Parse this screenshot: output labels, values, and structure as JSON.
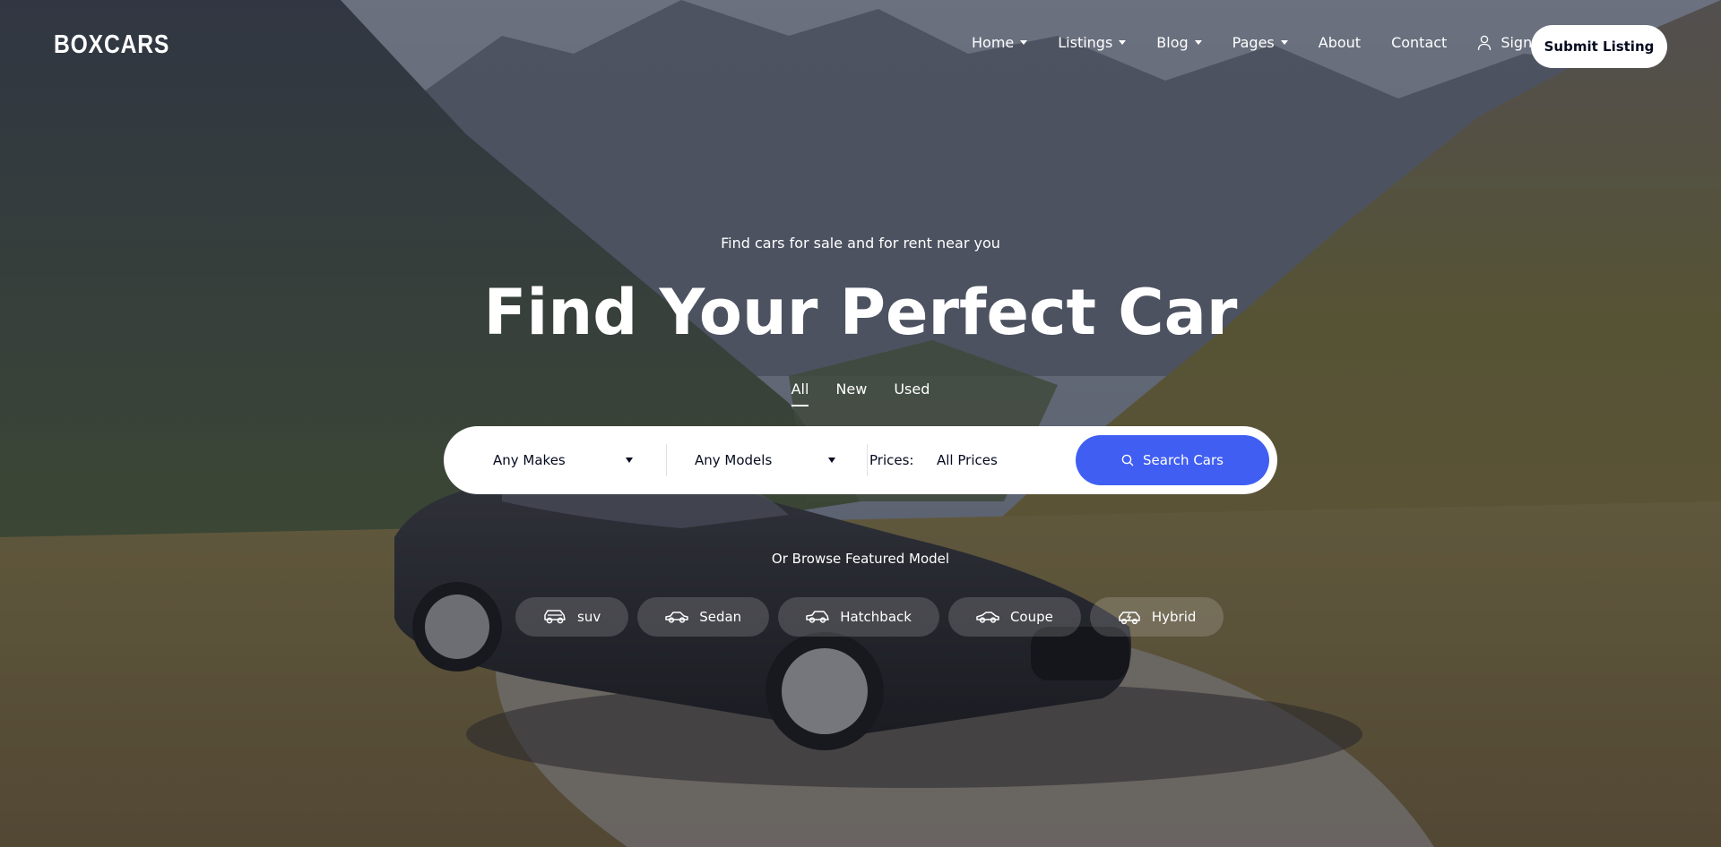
{
  "brand": {
    "logo_text": "BOXCARS"
  },
  "nav": {
    "items": [
      {
        "label": "Home",
        "has_dropdown": true
      },
      {
        "label": "Listings",
        "has_dropdown": true
      },
      {
        "label": "Blog",
        "has_dropdown": true
      },
      {
        "label": "Pages",
        "has_dropdown": true
      },
      {
        "label": "About",
        "has_dropdown": false
      },
      {
        "label": "Contact",
        "has_dropdown": false
      }
    ],
    "signin_label": "Sign in",
    "submit_label": "Submit Listing"
  },
  "hero": {
    "subtitle": "Find cars for sale and for rent near you",
    "headline": "Find Your Perfect Car",
    "tabs": [
      {
        "label": "All",
        "active": true
      },
      {
        "label": "New",
        "active": false
      },
      {
        "label": "Used",
        "active": false
      }
    ]
  },
  "search": {
    "makes_value": "Any Makes",
    "models_value": "Any Models",
    "prices_label": "Prices:",
    "prices_value": "All Prices",
    "button_label": "Search Cars"
  },
  "featured": {
    "heading": "Or Browse Featured Model",
    "chips": [
      {
        "label": "suv",
        "icon": "suv-icon"
      },
      {
        "label": "Sedan",
        "icon": "sedan-icon"
      },
      {
        "label": "Hatchback",
        "icon": "hatchback-icon"
      },
      {
        "label": "Coupe",
        "icon": "coupe-icon"
      },
      {
        "label": "Hybrid",
        "icon": "hybrid-icon"
      }
    ]
  },
  "colors": {
    "accent": "#405ff2",
    "text_dark": "#050b20",
    "white": "#ffffff"
  }
}
